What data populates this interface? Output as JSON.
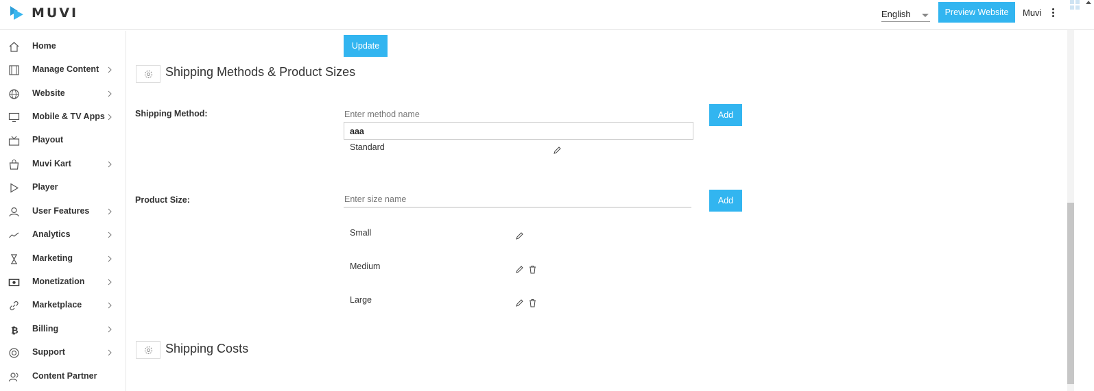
{
  "header": {
    "logo_text": "MUVI",
    "language": "English",
    "preview_label": "Preview Website",
    "user_name": "Muvi"
  },
  "sidebar": {
    "items": [
      {
        "label": "Home",
        "icon": "home-icon",
        "has_submenu": false
      },
      {
        "label": "Manage Content",
        "icon": "film-icon",
        "has_submenu": true
      },
      {
        "label": "Website",
        "icon": "globe-icon",
        "has_submenu": true
      },
      {
        "label": "Mobile & TV Apps",
        "icon": "monitor-icon",
        "has_submenu": true
      },
      {
        "label": "Playout",
        "icon": "tv-antenna-icon",
        "has_submenu": false
      },
      {
        "label": "Muvi Kart",
        "icon": "shopping-bag-icon",
        "has_submenu": true
      },
      {
        "label": "Player",
        "icon": "play-icon",
        "has_submenu": false
      },
      {
        "label": "User Features",
        "icon": "user-icon",
        "has_submenu": true
      },
      {
        "label": "Analytics",
        "icon": "trend-line-icon",
        "has_submenu": true
      },
      {
        "label": "Marketing",
        "icon": "hourglass-icon",
        "has_submenu": true
      },
      {
        "label": "Monetization",
        "icon": "cash-icon",
        "has_submenu": true
      },
      {
        "label": "Marketplace",
        "icon": "link-icon",
        "has_submenu": true
      },
      {
        "label": "Billing",
        "icon": "bitcoin-icon",
        "has_submenu": true
      },
      {
        "label": "Support",
        "icon": "lifebuoy-icon",
        "has_submenu": true
      },
      {
        "label": "Content Partner",
        "icon": "partner-icon",
        "has_submenu": false
      }
    ]
  },
  "main": {
    "update_label": "Update",
    "shipping_section": {
      "title": "Shipping Methods & Product Sizes",
      "method": {
        "label": "Shipping Method:",
        "placeholder": "Enter method name",
        "value": "",
        "suggestion": "aaa",
        "add_label": "Add",
        "items": [
          "Standard"
        ]
      },
      "size": {
        "label": "Product Size:",
        "placeholder": "Enter size name",
        "value": "",
        "add_label": "Add",
        "items": [
          {
            "name": "Small",
            "deletable": false
          },
          {
            "name": "Medium",
            "deletable": true
          },
          {
            "name": "Large",
            "deletable": true
          }
        ]
      }
    },
    "costs_section": {
      "title": "Shipping Costs"
    }
  },
  "colors": {
    "accent": "#32b5f0",
    "active_underline": "#2f80c8"
  }
}
